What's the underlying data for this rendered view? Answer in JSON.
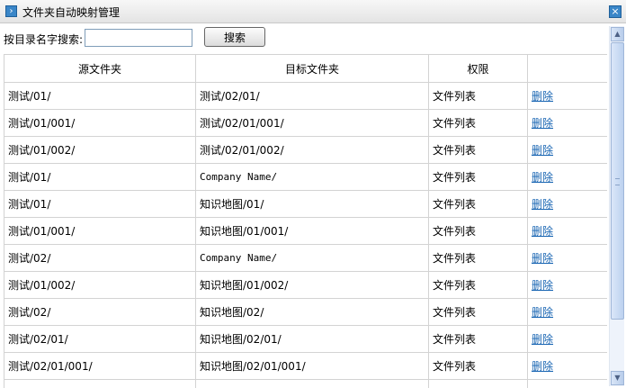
{
  "window": {
    "title": "文件夹自动映射管理"
  },
  "search": {
    "label": "按目录名字搜索:",
    "value": "",
    "button_label": "搜索"
  },
  "table": {
    "headers": [
      "源文件夹",
      "目标文件夹",
      "权限",
      ""
    ],
    "rows": [
      {
        "source": "测试/01/",
        "target": "测试/02/01/",
        "permission": "文件列表",
        "action": "删除"
      },
      {
        "source": "测试/01/001/",
        "target": "测试/02/01/001/",
        "permission": "文件列表",
        "action": "删除"
      },
      {
        "source": "测试/01/002/",
        "target": "测试/02/01/002/",
        "permission": "文件列表",
        "action": "删除"
      },
      {
        "source": "测试/01/",
        "target": "Company Name/",
        "permission": "文件列表",
        "action": "删除"
      },
      {
        "source": "测试/01/",
        "target": "知识地图/01/",
        "permission": "文件列表",
        "action": "删除"
      },
      {
        "source": "测试/01/001/",
        "target": "知识地图/01/001/",
        "permission": "文件列表",
        "action": "删除"
      },
      {
        "source": "测试/02/",
        "target": "Company Name/",
        "permission": "文件列表",
        "action": "删除"
      },
      {
        "source": "测试/01/002/",
        "target": "知识地图/01/002/",
        "permission": "文件列表",
        "action": "删除"
      },
      {
        "source": "测试/02/",
        "target": "知识地图/02/",
        "permission": "文件列表",
        "action": "删除"
      },
      {
        "source": "测试/02/01/",
        "target": "知识地图/02/01/",
        "permission": "文件列表",
        "action": "删除"
      },
      {
        "source": "测试/02/01/001/",
        "target": "知识地图/02/01/001/",
        "permission": "文件列表",
        "action": "删除"
      },
      {
        "source": "",
        "target": "",
        "permission": "",
        "action": ""
      }
    ]
  },
  "colors": {
    "accent": "#3a86c8",
    "link": "#1a66b3",
    "border": "#d3d3d3"
  },
  "icons": {
    "title": "arrow-right-icon",
    "close": "close-icon",
    "scroll_up": "scroll-up-icon",
    "scroll_down": "scroll-down-icon"
  }
}
